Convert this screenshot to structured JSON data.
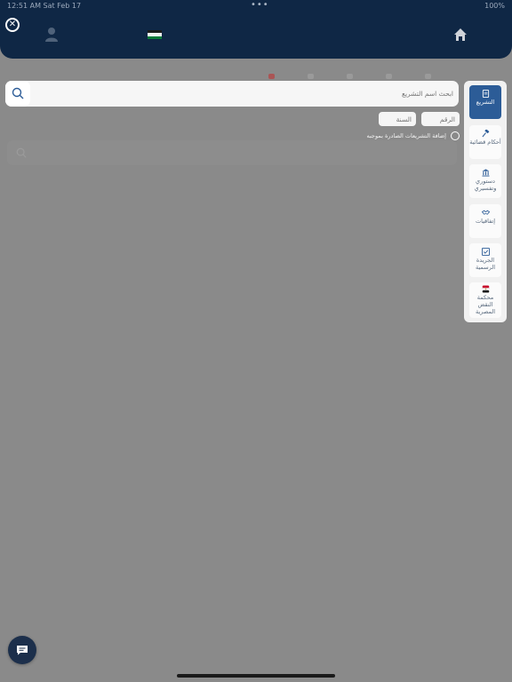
{
  "status_bar": {
    "time_date": "12:51 AM   Sat Feb 17",
    "battery": "100%"
  },
  "header": {
    "close_icon": "close-icon",
    "user_icon": "user-icon",
    "flag_icon": "jordan-flag-icon",
    "home_icon": "home-icon"
  },
  "search": {
    "placeholder": "ابحث اسم التشريع"
  },
  "filters": {
    "number_placeholder": "الرقم",
    "year_placeholder": "السنة"
  },
  "radio_option": {
    "label": "إضافة التشريعات الصادرة بموجبه"
  },
  "sidebar": {
    "items": [
      {
        "label": "التشريع",
        "icon": "legislation-icon",
        "active": true
      },
      {
        "label": "أحكام قضائية",
        "icon": "gavel-icon",
        "active": false
      },
      {
        "label": "دستوري وتفسيري",
        "icon": "institution-icon",
        "active": false
      },
      {
        "label": "إتفاقيات",
        "icon": "handshake-icon",
        "active": false
      },
      {
        "label": "الجريدة الرسمية",
        "icon": "gazette-icon",
        "active": false
      },
      {
        "label": "محكمة النقض المصرية",
        "icon": "egypt-flag-icon",
        "active": false
      }
    ]
  },
  "colors": {
    "header": "#0f2745",
    "active_tab": "#2c5c97",
    "overlay": "#8a8a8a"
  }
}
